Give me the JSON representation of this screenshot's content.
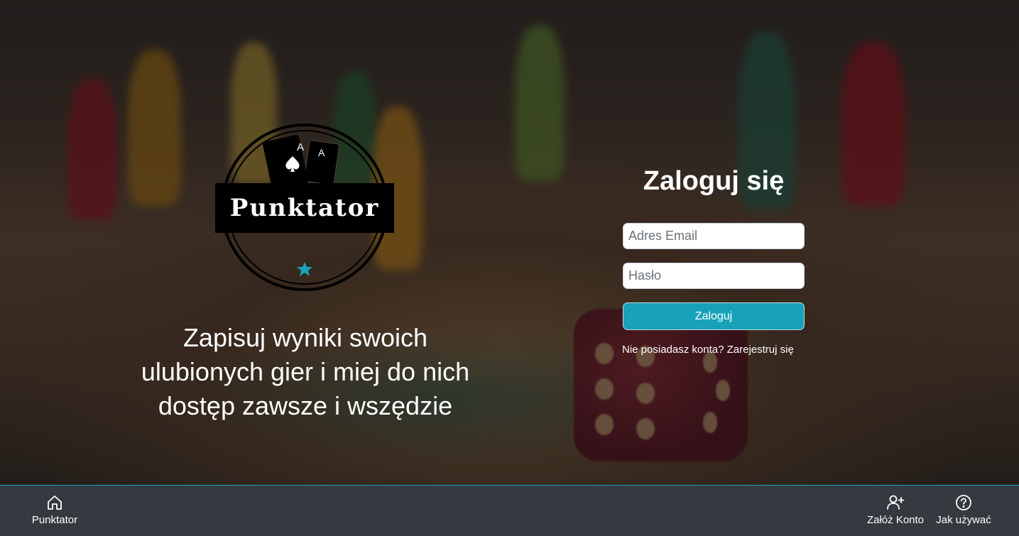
{
  "brand": {
    "logo_text": "Punktator"
  },
  "hero": {
    "tagline_line1": "Zapisuj wyniki swoich",
    "tagline_line2": "ulubionych gier i miej do nich",
    "tagline_line3": "dostęp zawsze i wszędzie"
  },
  "login": {
    "title": "Zaloguj się",
    "email_placeholder": "Adres Email",
    "password_placeholder": "Hasło",
    "submit_label": "Zaloguj",
    "no_account_text": "Nie posiadasz konta?",
    "register_link": "Zarejestruj się"
  },
  "navbar": {
    "home_label": "Punktator",
    "register_label": "Załóż Konto",
    "help_label": "Jak używać"
  },
  "colors": {
    "accent": "#17a2b8",
    "navbar_bg": "#343a40"
  }
}
